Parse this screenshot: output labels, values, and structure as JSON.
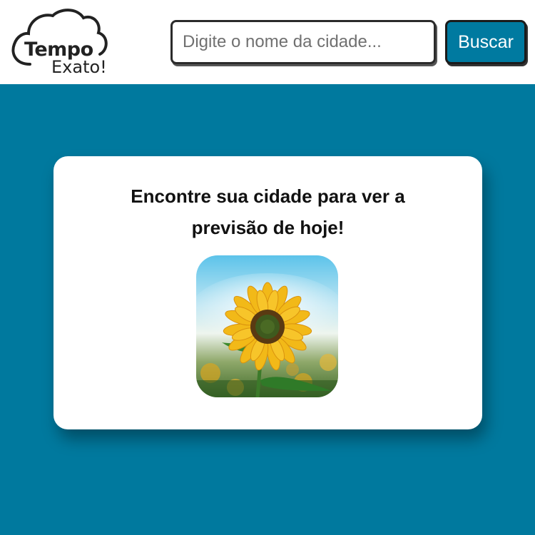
{
  "header": {
    "logo": {
      "line1": "Tempo",
      "line2": "Exato!",
      "icon": "cloud-icon"
    },
    "search": {
      "placeholder": "Digite o nome da cidade...",
      "value": ""
    },
    "search_button_label": "Buscar"
  },
  "card": {
    "title": "Encontre sua cidade para ver a previsão de hoje!",
    "image": "sunflower-photo"
  },
  "colors": {
    "background": "#00799e",
    "header_bg": "#ffffff",
    "button_bg": "#007aa0",
    "card_bg": "#ffffff"
  }
}
